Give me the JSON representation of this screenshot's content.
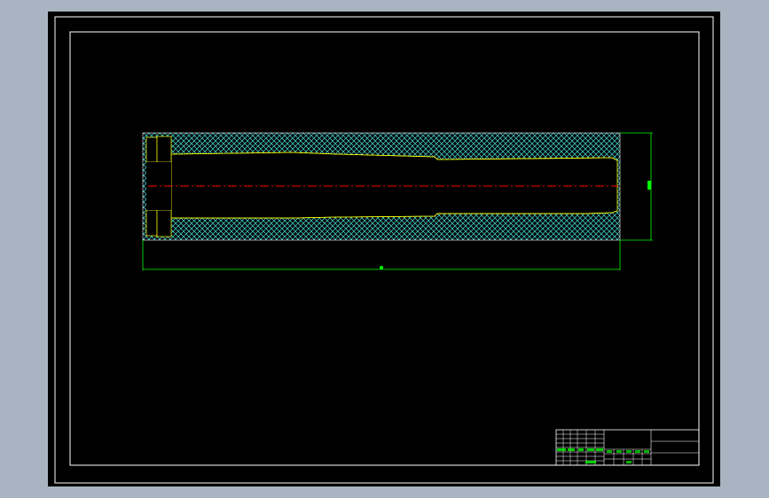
{
  "viewport": {
    "background_color": "#a9b4c2",
    "model_space_color": "#000000"
  },
  "drawing": {
    "frame_color": "#ffffff",
    "geometry_color": "#ffff00",
    "hatch_color": "#3fbfbf",
    "dimension_color": "#00ff00",
    "centerline_color": "#ff0000",
    "dimensions": {
      "overall_length": "",
      "overall_diameter": ""
    }
  },
  "title_block": {
    "cells": []
  }
}
